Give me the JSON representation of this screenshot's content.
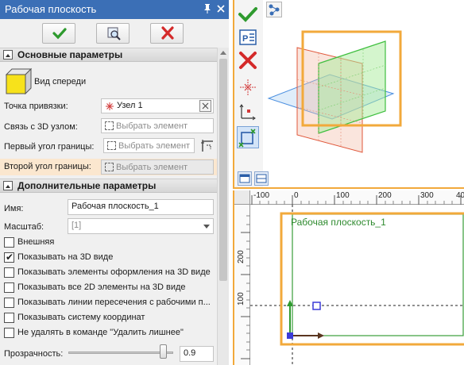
{
  "panel": {
    "title": "Рабочая плоскость",
    "icons": [
      "pin-icon",
      "close-icon"
    ]
  },
  "toolbar": {
    "ok_icon": "checkmark-icon",
    "preview_icon": "preview-icon",
    "cancel_icon": "cross-icon"
  },
  "section_main": {
    "title": "Основные параметры",
    "view_label": "Вид спереди",
    "anchor_label": "Точка привязки:",
    "anchor_value": "Узел 1",
    "link3d_label": "Связь с 3D узлом:",
    "link3d_placeholder": "Выбрать элемент",
    "corner1_label": "Первый угол границы:",
    "corner1_placeholder": "Выбрать элемент",
    "corner2_label": "Второй угол границы:",
    "corner2_placeholder": "Выбрать элемент"
  },
  "section_extra": {
    "title": "Дополнительные параметры",
    "name_label": "Имя:",
    "name_value": "Рабочая плоскость_1",
    "scale_label": "Масштаб:",
    "scale_value": "[1]",
    "checkboxes": [
      {
        "label": "Внешняя",
        "checked": false
      },
      {
        "label": "Показывать на 3D виде",
        "checked": true
      },
      {
        "label": "Показывать элементы оформления на 3D виде",
        "checked": false
      },
      {
        "label": "Показывать все 2D элементы на 3D виде",
        "checked": false
      },
      {
        "label": "Показывать линии пересечения с рабочими п...",
        "checked": false
      },
      {
        "label": "Показывать систему координат",
        "checked": false
      },
      {
        "label": "Не удалять в команде \"Удалить лишнее\"",
        "checked": false
      }
    ],
    "transparency_label": "Прозрачность:",
    "transparency_value": "0.9",
    "transparency_level": 0.9
  },
  "viewport_2d": {
    "plane_label": "Рабочая плоскость_1",
    "ruler_h": [
      "-100",
      "0",
      "100",
      "200",
      "300",
      "40"
    ],
    "ruler_v": [
      "200",
      "100"
    ]
  },
  "colors": {
    "title_bar": "#3b6fb6",
    "accent_orange": "#f2a93b",
    "plane_green": "#3fbf3f",
    "plane_red": "#e0573a",
    "plane_blue": "#4a8fe0"
  }
}
